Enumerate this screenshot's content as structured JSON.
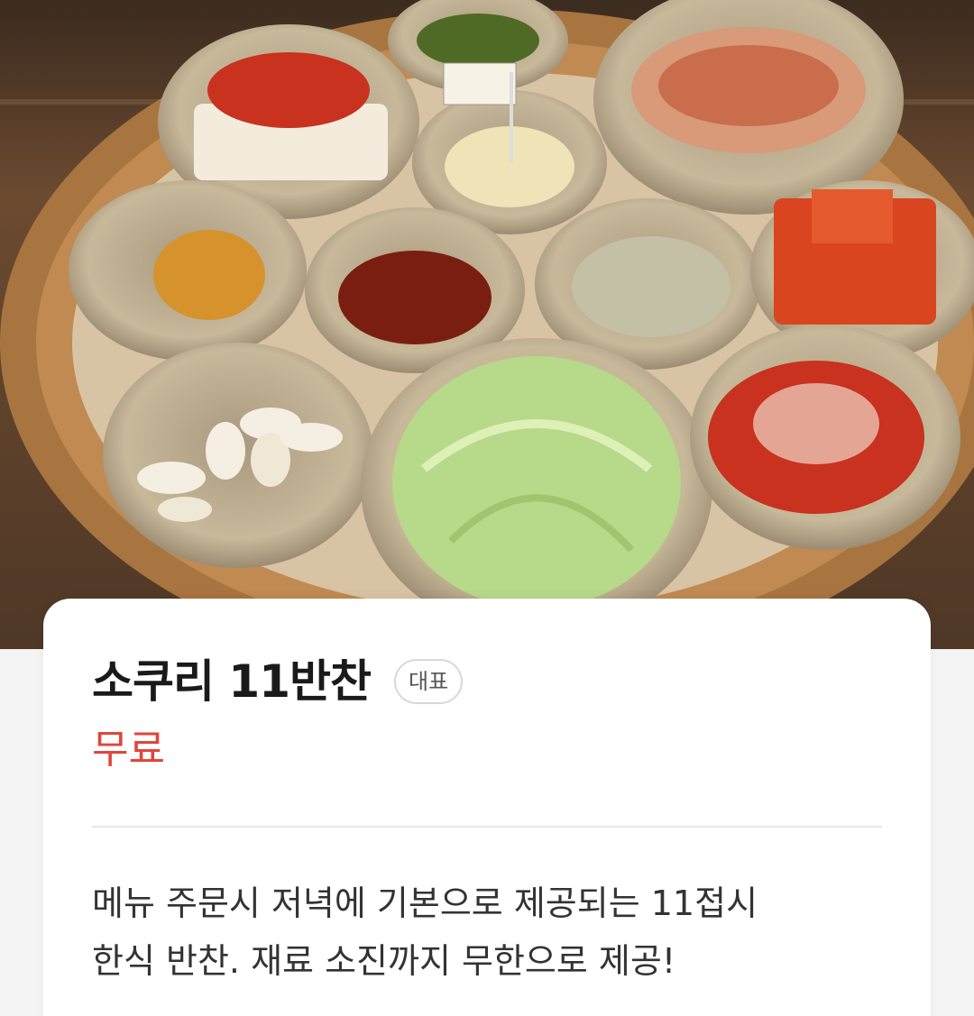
{
  "hero_image": {
    "alt_icon": "food-photo",
    "flag_text": "",
    "colors": {
      "wood": "#6b4a30",
      "basket": "#b07a45",
      "brass_bowl": "#c8b89a",
      "kimchi_red": "#c8321e",
      "cabbage_green": "#b6d98a"
    }
  },
  "menu_item": {
    "name": "소쿠리 11반찬",
    "badge": "대표",
    "price": "무료",
    "description": "메뉴 주문시 저녁에 기본으로 제공되는 11접시\n한식 반찬. 재료 소진까지 무한으로 제공!"
  },
  "colors": {
    "price_red": "#e0453b",
    "title_text": "#1a1a1a",
    "badge_border": "#d8d8d8",
    "divider": "#e6e6e6"
  }
}
